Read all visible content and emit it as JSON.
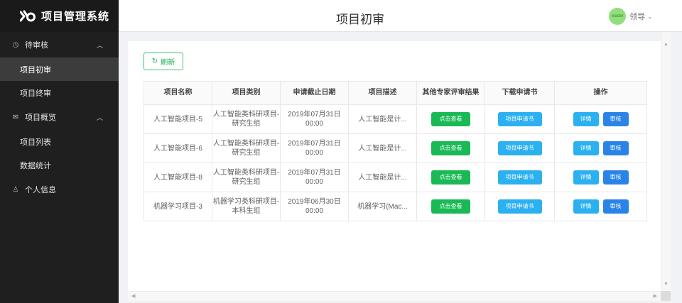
{
  "app": {
    "title": "项目管理系统"
  },
  "sidebar": {
    "groups": [
      {
        "label": "待审核",
        "icon": "clock-icon",
        "expanded": true,
        "items": [
          {
            "label": "项目初审",
            "active": true
          },
          {
            "label": "项目终审",
            "active": false
          }
        ]
      },
      {
        "label": "项目概览",
        "icon": "mail-icon",
        "expanded": true,
        "items": [
          {
            "label": "项目列表",
            "active": false
          },
          {
            "label": "数据统计",
            "active": false
          }
        ]
      },
      {
        "label": "个人信息",
        "icon": "user-icon",
        "expanded": false,
        "items": []
      }
    ]
  },
  "header": {
    "page_title": "项目初审",
    "avatar_text": "leader",
    "username": "领导"
  },
  "toolbar": {
    "refresh_label": "刷新"
  },
  "table": {
    "columns": [
      "项目名称",
      "项目类别",
      "申请截止日期",
      "项目描述",
      "其他专家评审结果",
      "下载申请书",
      "操作"
    ],
    "rows": [
      {
        "name": "人工智能项目-5",
        "category": "人工智能类科研项目-研究生组",
        "deadline_date": "2019年07月31日",
        "deadline_time": "00:00",
        "desc": "人工智能是计...",
        "result_btn": "点击查看",
        "download_btn": "项目申请书",
        "detail_btn": "详情",
        "review_btn": "审核"
      },
      {
        "name": "人工智能项目-6",
        "category": "人工智能类科研项目-研究生组",
        "deadline_date": "2019年07月31日",
        "deadline_time": "00:00",
        "desc": "人工智能是计...",
        "result_btn": "点击查看",
        "download_btn": "项目申请书",
        "detail_btn": "详情",
        "review_btn": "审核"
      },
      {
        "name": "人工智能项目-8",
        "category": "人工智能类科研项目-研究生组",
        "deadline_date": "2019年07月31日",
        "deadline_time": "00:00",
        "desc": "人工智能是计...",
        "result_btn": "点击查看",
        "download_btn": "项目申请书",
        "detail_btn": "详情",
        "review_btn": "审核"
      },
      {
        "name": "机器学习项目-3",
        "category": "机器学习类科研项目-本科生组",
        "deadline_date": "2019年06月30日",
        "deadline_time": "00:00",
        "desc": "机器学习(Mac...",
        "result_btn": "点击查看",
        "download_btn": "项目申请书",
        "detail_btn": "详情",
        "review_btn": "审核"
      }
    ]
  },
  "colors": {
    "sidebar_bg": "#1f1f1f",
    "active_item_bg": "#3c3c3c",
    "green": "#19b955",
    "cyan": "#2bb0f0",
    "blue": "#2a84e8"
  }
}
